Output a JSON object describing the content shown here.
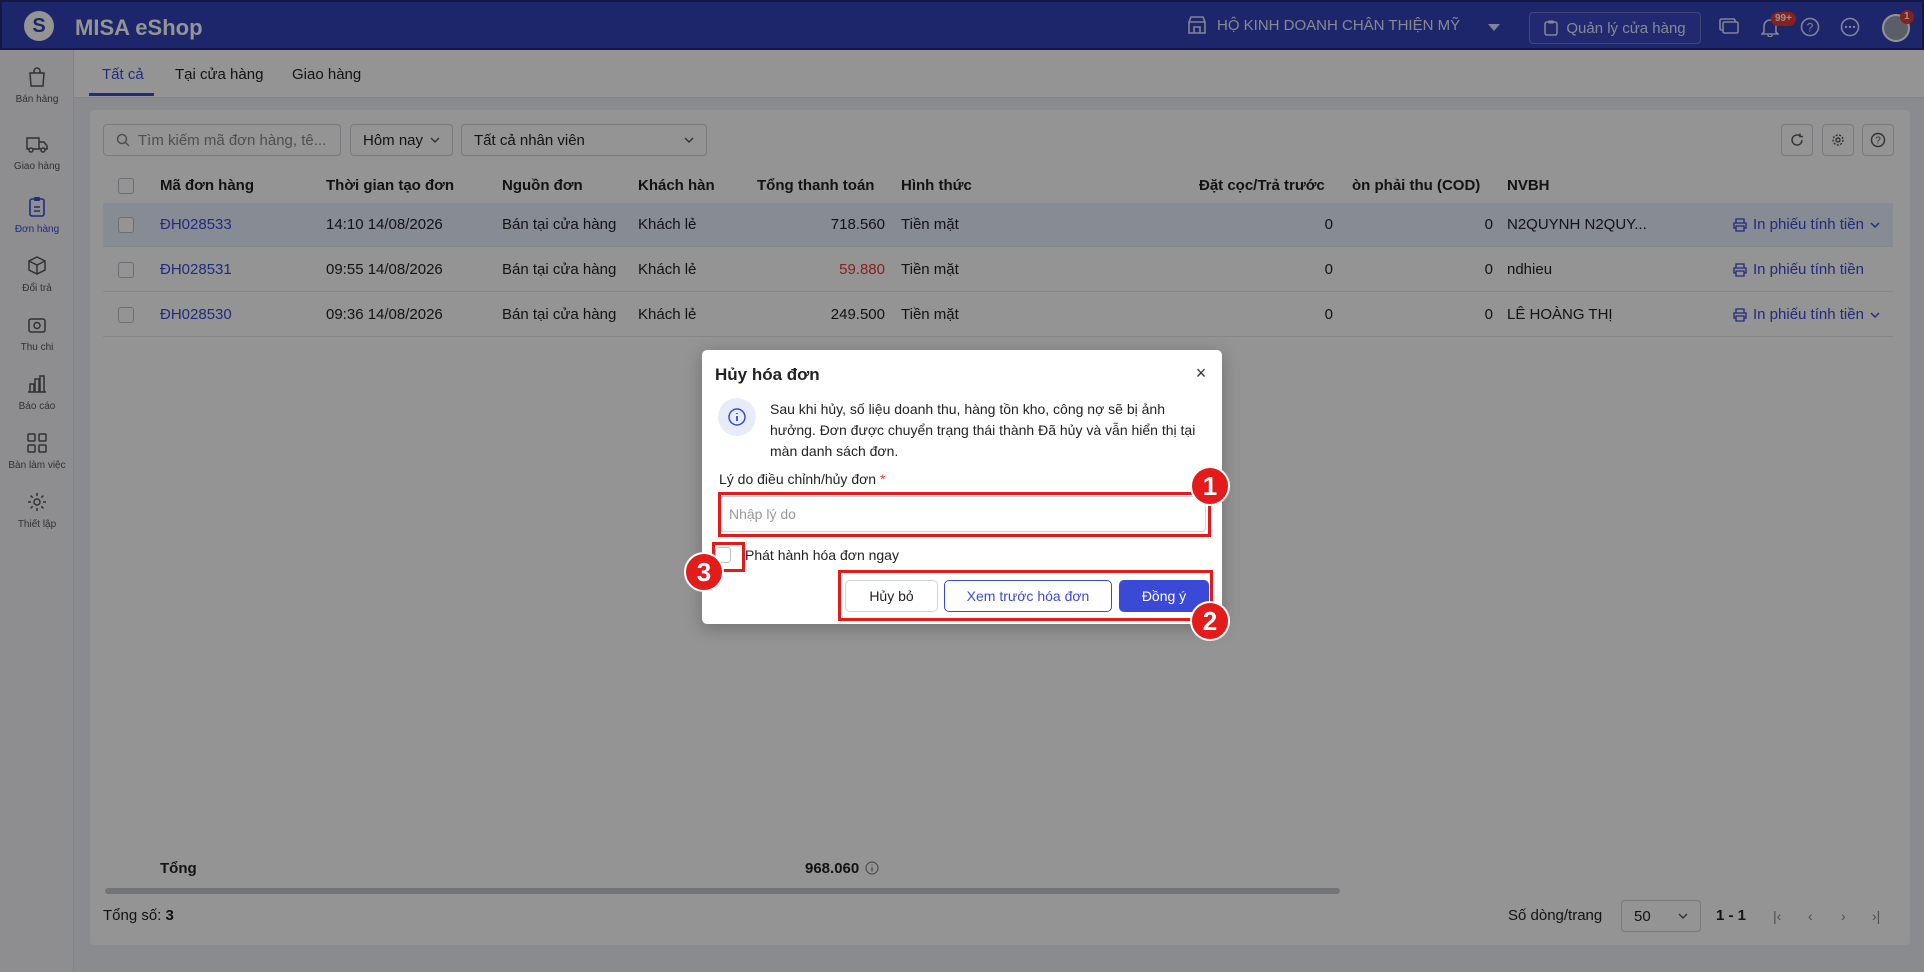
{
  "app": {
    "title": "MISA eShop"
  },
  "topbar": {
    "store_name": "HỘ KINH DOANH CHÂN THIỆN MỸ",
    "manage_store_label": "Quản lý cửa hàng",
    "notification_badge": "99+",
    "avatar_badge": "1"
  },
  "sidebar": {
    "items": [
      {
        "label": "Bán hàng",
        "icon": "bag-icon"
      },
      {
        "label": "Giao hàng",
        "icon": "truck-icon"
      },
      {
        "label": "Đơn hàng",
        "icon": "clipboard-icon",
        "active": true
      },
      {
        "label": "Đổi trả",
        "icon": "box-return-icon"
      },
      {
        "label": "Thu chi",
        "icon": "cash-icon"
      },
      {
        "label": "Báo cáo",
        "icon": "chart-icon"
      },
      {
        "label": "Bàn làm việc",
        "icon": "grid-icon"
      },
      {
        "label": "Thiết lập",
        "icon": "gear-icon"
      }
    ]
  },
  "tabs": [
    {
      "label": "Tất cả",
      "active": true
    },
    {
      "label": "Tại cửa hàng"
    },
    {
      "label": "Giao hàng"
    }
  ],
  "filters": {
    "search_placeholder": "Tìm kiếm mã đơn hàng, tê...",
    "date_range": "Hôm nay",
    "staff": "Tất cả nhân viên"
  },
  "table": {
    "columns": [
      "Mã đơn hàng",
      "Thời gian tạo đơn",
      "Nguồn đơn",
      "Khách hàn",
      "Tổng thanh toán",
      "Hình thức",
      "Đặt cọc/Trả trước",
      "òn phải thu (COD)",
      "NVBH"
    ],
    "print_label": "In phiếu tính tiền",
    "rows": [
      {
        "code": "ĐH028533",
        "time": "14:10 14/08/2026",
        "source": "Bán tại cửa hàng",
        "customer": "Khách lẻ",
        "total": "718.560",
        "method": "Tiền mặt",
        "deposit": "0",
        "cod": "0",
        "staff": "N2QUYNH N2QUY..."
      },
      {
        "code": "ĐH028531",
        "time": "09:55 14/08/2026",
        "source": "Bán tại cửa hàng",
        "customer": "Khách lẻ",
        "total": "59.880",
        "method": "Tiền mặt",
        "deposit": "0",
        "cod": "0",
        "staff": "ndhieu"
      },
      {
        "code": "ĐH028530",
        "time": "09:36 14/08/2026",
        "source": "Bán tại cửa hàng",
        "customer": "Khách lẻ",
        "total": "249.500",
        "method": "Tiền mặt",
        "deposit": "0",
        "cod": "0",
        "staff": "LÊ HOÀNG THỊ"
      }
    ],
    "total_label": "Tổng",
    "total_value": "968.060"
  },
  "footer": {
    "total_count_label": "Tổng số:",
    "total_count": "3",
    "rows_per_page_label": "Số dòng/trang",
    "rows_per_page": "50",
    "range": "1 - 1"
  },
  "modal": {
    "title": "Hủy hóa đơn",
    "info_text": "Sau khi hủy, số liệu doanh thu, hàng tồn kho, công nợ sẽ bị ảnh hưởng. Đơn được chuyển trạng thái thành Đã hủy và vẫn hiển thị tại màn danh sách đơn.",
    "reason_label": "Lý do điều chỉnh/hủy đơn",
    "required_mark": "*",
    "reason_placeholder": "Nhập lý do",
    "issue_now_label": "Phát hành hóa đơn ngay",
    "cancel_label": "Hủy bỏ",
    "preview_label": "Xem trước hóa đơn",
    "ok_label": "Đồng ý"
  },
  "annotations": [
    "1",
    "2",
    "3"
  ],
  "colors": {
    "brand": "#3340b8",
    "accent": "#3b4ad6",
    "danger": "#e53935",
    "annotation": "#e31b1b"
  }
}
